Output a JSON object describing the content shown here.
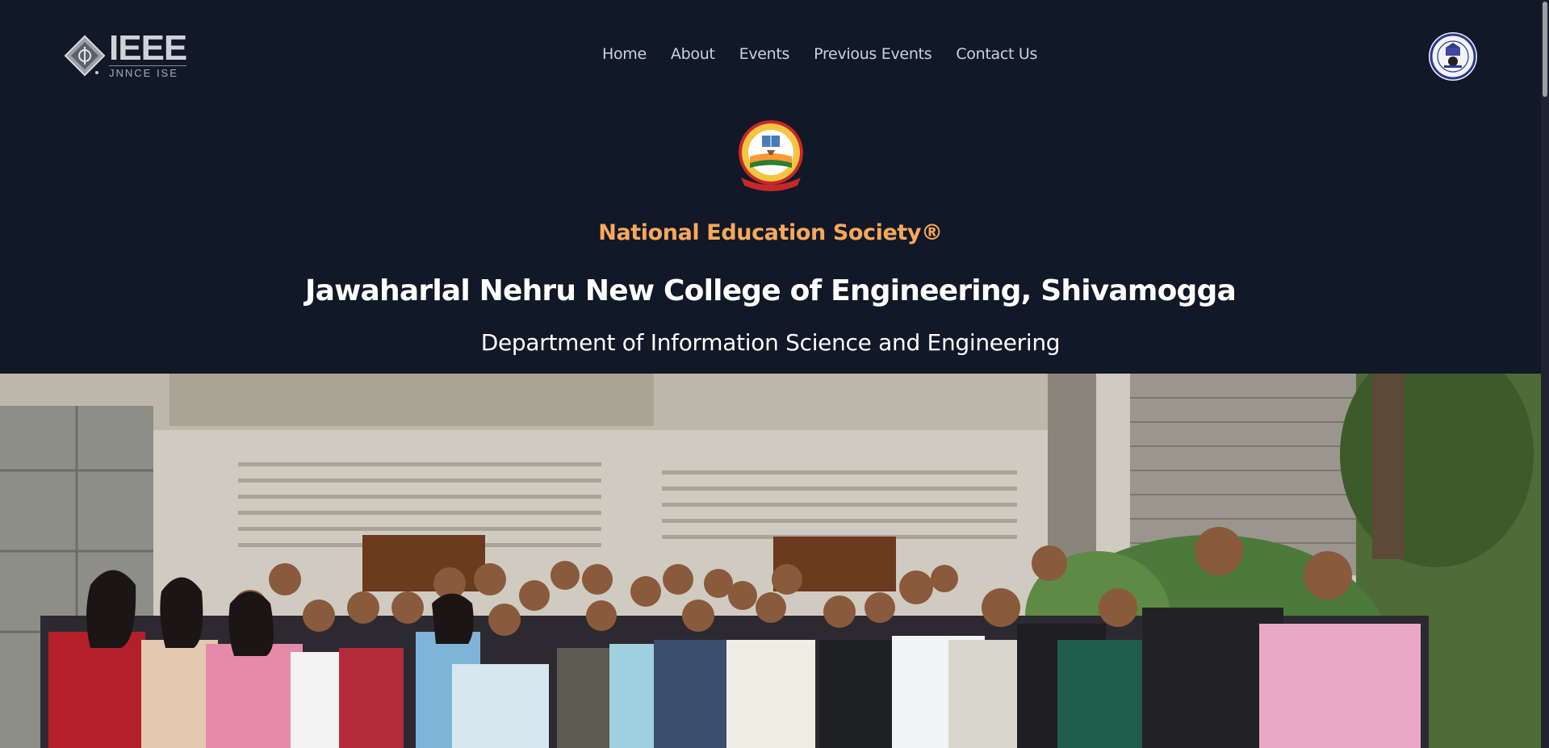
{
  "header": {
    "brand": {
      "main": "IEEE",
      "sub": "JNNCE ISE"
    },
    "nav": [
      {
        "label": "Home"
      },
      {
        "label": "About"
      },
      {
        "label": "Events"
      },
      {
        "label": "Previous Events"
      },
      {
        "label": "Contact Us"
      }
    ]
  },
  "hero": {
    "society": "National Education Society®",
    "college": "Jawaharlal Nehru New College of Engineering, Shivamogga",
    "department": "Department of Information Science and Engineering"
  },
  "colors": {
    "background": "#111827",
    "accent": "#f6a85a",
    "text": "#ffffff",
    "nav_text": "#cbd2dc"
  },
  "icons": {
    "brand": "ieee-diamond-logo",
    "seal": "college-seal-icon",
    "society": "nes-emblem-icon"
  }
}
